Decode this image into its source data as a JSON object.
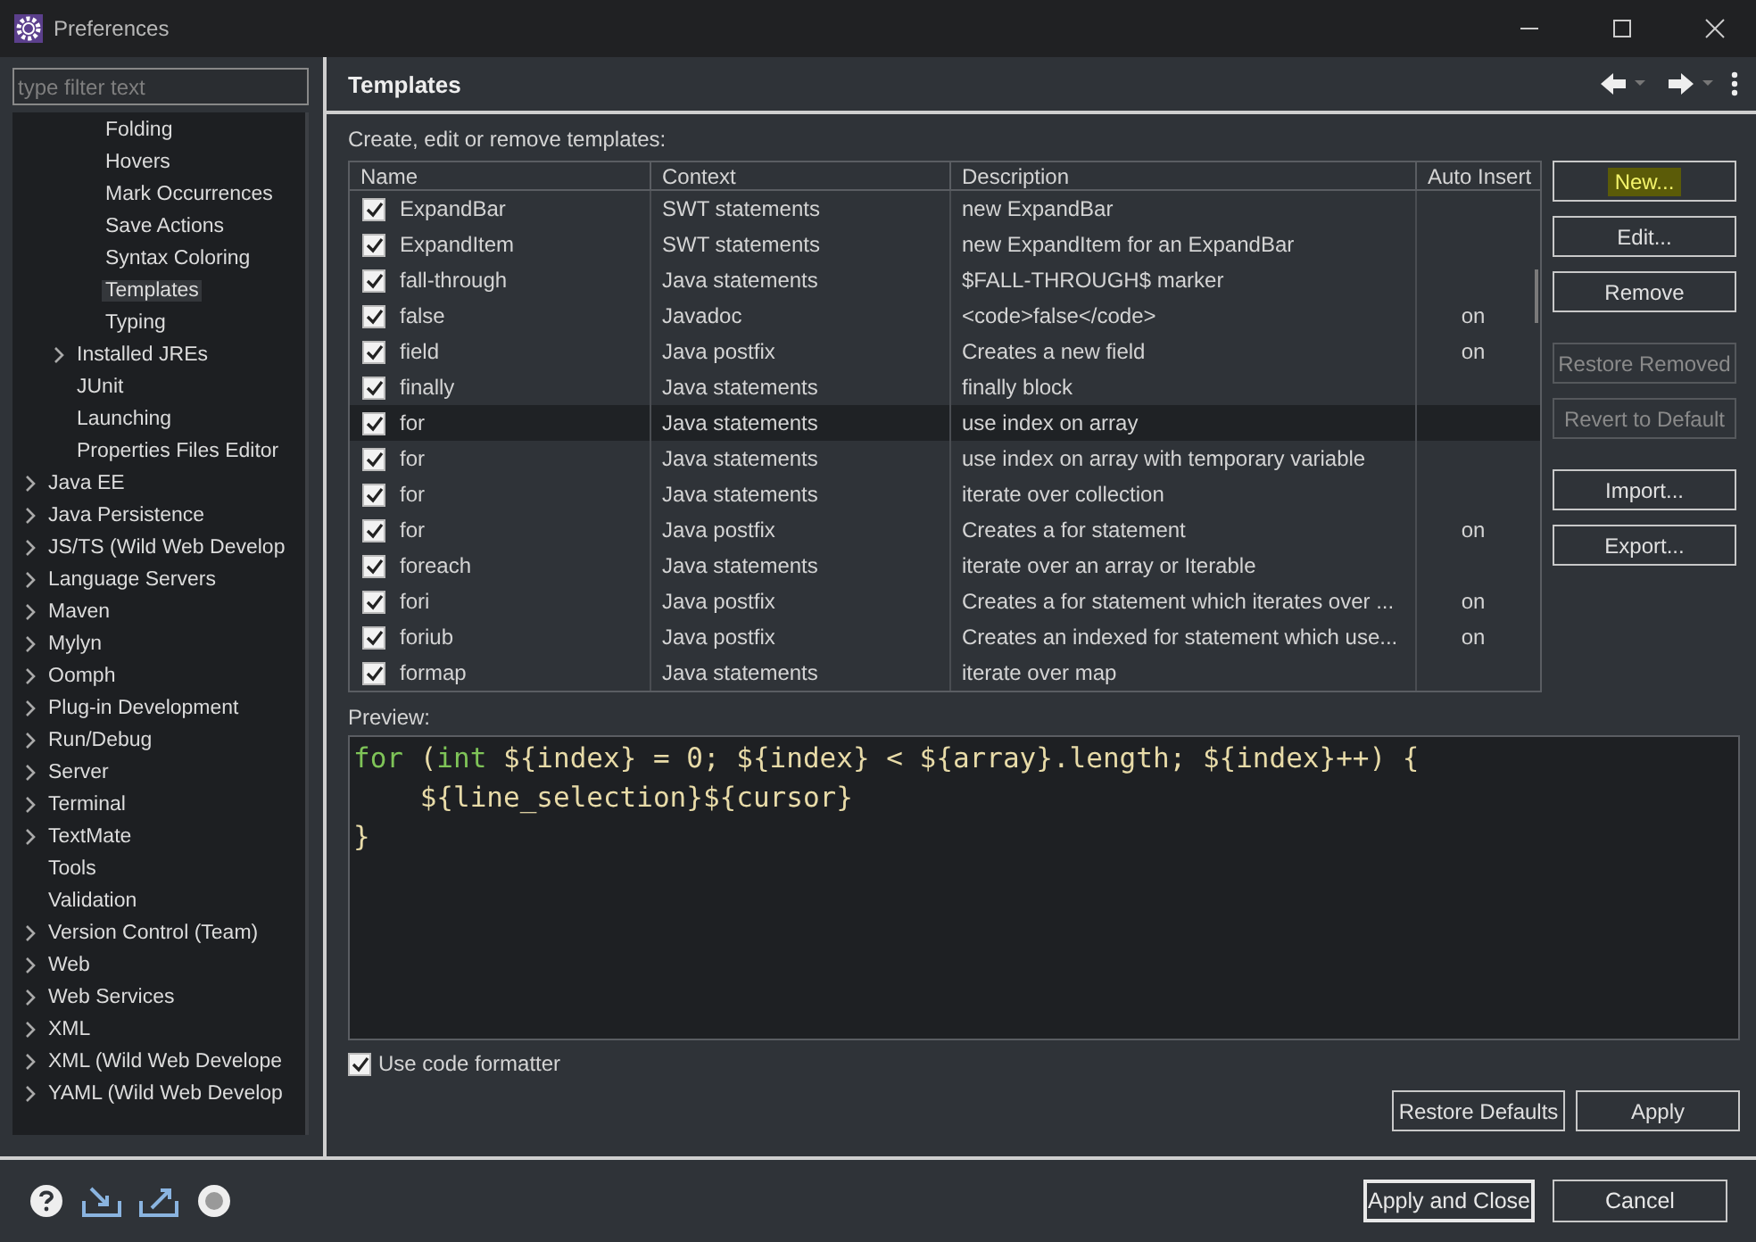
{
  "window": {
    "title": "Preferences"
  },
  "filter": {
    "placeholder": "type filter text"
  },
  "tree": [
    {
      "children": [
        {
          "children": [
            {
              "label": "Folding",
              "expandable": false,
              "selected": false
            },
            {
              "label": "Hovers",
              "expandable": false,
              "selected": false
            },
            {
              "label": "Mark Occurrences",
              "expandable": false,
              "selected": false
            },
            {
              "label": "Save Actions",
              "expandable": false,
              "selected": false
            },
            {
              "label": "Syntax Coloring",
              "expandable": false,
              "selected": false
            },
            {
              "label": "Templates",
              "expandable": false,
              "selected": true
            },
            {
              "label": "Typing",
              "expandable": false,
              "selected": false
            }
          ]
        },
        {
          "label": "Installed JREs",
          "expandable": true,
          "selected": false
        },
        {
          "label": "JUnit",
          "expandable": false,
          "selected": false
        },
        {
          "label": "Launching",
          "expandable": false,
          "selected": false
        },
        {
          "label": "Properties Files Editor",
          "expandable": false,
          "selected": false
        }
      ]
    },
    {
      "label": "Java EE",
      "expandable": true,
      "selected": false
    },
    {
      "label": "Java Persistence",
      "expandable": true,
      "selected": false
    },
    {
      "label": "JS/TS (Wild Web Develop",
      "expandable": true,
      "selected": false
    },
    {
      "label": "Language Servers",
      "expandable": true,
      "selected": false
    },
    {
      "label": "Maven",
      "expandable": true,
      "selected": false
    },
    {
      "label": "Mylyn",
      "expandable": true,
      "selected": false
    },
    {
      "label": "Oomph",
      "expandable": true,
      "selected": false
    },
    {
      "label": "Plug-in Development",
      "expandable": true,
      "selected": false
    },
    {
      "label": "Run/Debug",
      "expandable": true,
      "selected": false
    },
    {
      "label": "Server",
      "expandable": true,
      "selected": false
    },
    {
      "label": "Terminal",
      "expandable": true,
      "selected": false
    },
    {
      "label": "TextMate",
      "expandable": true,
      "selected": false
    },
    {
      "label": "Tools",
      "expandable": false,
      "selected": false
    },
    {
      "label": "Validation",
      "expandable": false,
      "selected": false
    },
    {
      "label": "Version Control (Team)",
      "expandable": true,
      "selected": false
    },
    {
      "label": "Web",
      "expandable": true,
      "selected": false
    },
    {
      "label": "Web Services",
      "expandable": true,
      "selected": false
    },
    {
      "label": "XML",
      "expandable": true,
      "selected": false
    },
    {
      "label": "XML (Wild Web Develope",
      "expandable": true,
      "selected": false
    },
    {
      "label": "YAML (Wild Web Develop",
      "expandable": true,
      "selected": false
    }
  ],
  "page": {
    "title": "Templates",
    "intro": "Create, edit or remove templates:"
  },
  "table": {
    "columns": [
      "Name",
      "Context",
      "Description",
      "Auto Insert"
    ],
    "rows": [
      {
        "name": "ExpandBar",
        "checked": true,
        "context": "SWT statements",
        "description": "new ExpandBar",
        "auto_insert": "",
        "selected": false
      },
      {
        "name": "ExpandItem",
        "checked": true,
        "context": "SWT statements",
        "description": "new ExpandItem for an ExpandBar",
        "auto_insert": "",
        "selected": false
      },
      {
        "name": "fall-through",
        "checked": true,
        "context": "Java statements",
        "description": "$FALL-THROUGH$ marker",
        "auto_insert": "",
        "selected": false
      },
      {
        "name": "false",
        "checked": true,
        "context": "Javadoc",
        "description": "<code>false</code>",
        "auto_insert": "on",
        "selected": false
      },
      {
        "name": "field",
        "checked": true,
        "context": "Java postfix",
        "description": "Creates a new field",
        "auto_insert": "on",
        "selected": false
      },
      {
        "name": "finally",
        "checked": true,
        "context": "Java statements",
        "description": "finally block",
        "auto_insert": "",
        "selected": false
      },
      {
        "name": "for",
        "checked": true,
        "context": "Java statements",
        "description": "use index on array",
        "auto_insert": "",
        "selected": true
      },
      {
        "name": "for",
        "checked": true,
        "context": "Java statements",
        "description": "use index on array with temporary variable",
        "auto_insert": "",
        "selected": false
      },
      {
        "name": "for",
        "checked": true,
        "context": "Java statements",
        "description": "iterate over collection",
        "auto_insert": "",
        "selected": false
      },
      {
        "name": "for",
        "checked": true,
        "context": "Java postfix",
        "description": "Creates a for statement",
        "auto_insert": "on",
        "selected": false
      },
      {
        "name": "foreach",
        "checked": true,
        "context": "Java statements",
        "description": "iterate over an array or Iterable",
        "auto_insert": "",
        "selected": false
      },
      {
        "name": "fori",
        "checked": true,
        "context": "Java postfix",
        "description": "Creates a for statement which iterates over ...",
        "auto_insert": "on",
        "selected": false
      },
      {
        "name": "foriub",
        "checked": true,
        "context": "Java postfix",
        "description": "Creates an indexed for statement which use...",
        "auto_insert": "on",
        "selected": false
      },
      {
        "name": "formap",
        "checked": true,
        "context": "Java statements",
        "description": "iterate over map",
        "auto_insert": "",
        "selected": false
      }
    ]
  },
  "side_button_groups": [
    [
      {
        "label": "New...",
        "disabled": false,
        "highlighted": true
      },
      {
        "label": "Edit...",
        "disabled": false,
        "highlighted": false
      },
      {
        "label": "Remove",
        "disabled": false,
        "highlighted": false
      }
    ],
    [
      {
        "label": "Restore Removed",
        "disabled": true,
        "highlighted": false
      },
      {
        "label": "Revert to Default",
        "disabled": true,
        "highlighted": false
      }
    ],
    [
      {
        "label": "Import...",
        "disabled": false,
        "highlighted": false
      },
      {
        "label": "Export...",
        "disabled": false,
        "highlighted": false
      }
    ]
  ],
  "preview": {
    "label": "Preview:",
    "lines": [
      [
        {
          "kind": "keyword",
          "text": "for"
        },
        {
          "kind": "text",
          "text": " ("
        },
        {
          "kind": "keyword",
          "text": "int"
        },
        {
          "kind": "text",
          "text": " ${index} = 0; ${index} < ${array}.length; ${index}++) {"
        }
      ],
      [
        {
          "kind": "text",
          "text": "    ${line_selection}${cursor}"
        }
      ],
      [
        {
          "kind": "text",
          "text": "}"
        }
      ]
    ]
  },
  "use_code_formatter": {
    "label": "Use code formatter",
    "checked": true
  },
  "page_buttons": [
    "Restore Defaults",
    "Apply"
  ],
  "dialog_buttons": [
    {
      "label": "Apply and Close",
      "default": true
    },
    {
      "label": "Cancel",
      "default": false
    }
  ]
}
